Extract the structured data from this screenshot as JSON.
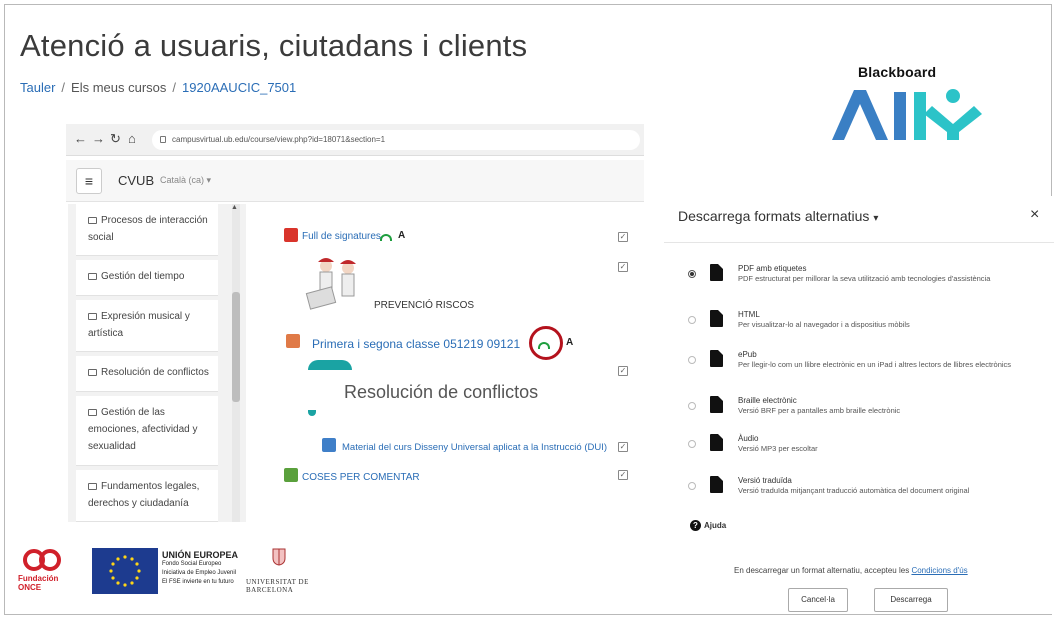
{
  "header": {
    "title": "Atenció a usuaris, ciutadans i clients",
    "breadcrumb": [
      "Tauler",
      "Els meus cursos",
      "1920AAUCIC_7501"
    ]
  },
  "logos": {
    "blackboard": "Blackboard",
    "ally": "ALLY"
  },
  "browser": {
    "url": "campusvirtual.ub.edu/course/view.php?id=18071&section=1",
    "site_name": "CVUB",
    "lang": "Català (ca) ▾"
  },
  "sidebar": {
    "items": [
      {
        "label": "Procesos de interacción social"
      },
      {
        "label": "Gestión del tiempo"
      },
      {
        "label": "Expresión musical y artística"
      },
      {
        "label": "Resolución de conflictos"
      },
      {
        "label": "Gestión de las emociones, afectividad y sexualidad"
      },
      {
        "label": "Fundamentos legales, derechos y ciudadanía"
      }
    ]
  },
  "content": {
    "activity1": "Full de signatures",
    "label1": "PREVENCIÓ RISCOS",
    "activity2": "Primera i segona classe 051219 09121",
    "big_label": "Resolución de conflictos",
    "activity3": "Material del curs Disseny Universal aplicat a la Instrucció (DUI)",
    "activity4": "COSES PER COMENTAR",
    "a_icon": "A"
  },
  "panel": {
    "title": "Descarrega formats alternatius",
    "close": "×",
    "formats": [
      {
        "name": "PDF amb etiquetes",
        "desc": "PDF estructurat per millorar la seva utilització amb tecnologies d'assistència",
        "selected": true
      },
      {
        "name": "HTML",
        "desc": "Per visualitzar-lo al navegador i a dispositius mòbils",
        "selected": false
      },
      {
        "name": "ePub",
        "desc": "Per llegir-lo com un llibre electrònic en un iPad i altres lectors de llibres electrònics",
        "selected": false
      },
      {
        "name": "Braille electrònic",
        "desc": "Versió BRF per a pantalles amb braille electrònic",
        "selected": false
      },
      {
        "name": "Àudio",
        "desc": "Versió MP3 per escoltar",
        "selected": false
      },
      {
        "name": "Versió traduïda",
        "desc": "Versió traduïda mitjançant traducció automàtica del document original",
        "selected": false
      }
    ],
    "help": "Ajuda",
    "terms_prefix": "En descarregar un format alternatiu, accepteu les ",
    "terms_link": "Condicions d'ús",
    "cancel": "Cancel·la",
    "download": "Descarrega"
  },
  "footer": {
    "once": "Fundación ONCE",
    "eu_title": "UNIÓN EUROPEA",
    "eu_fund": "Fondo Social Europeo",
    "eu_line1": "Iniciativa de Empleo Juvenil",
    "eu_line2": "El FSE invierte en tu futuro",
    "ub_line1": "UNIVERSITAT DE",
    "ub_line2": "BARCELONA"
  },
  "colors": {
    "link": "#2a6db6",
    "ally_blue": "#3a7fc4",
    "ally_teal": "#2cc3c8",
    "highlight_red": "#b4121d",
    "gauge_green": "#1e9e3e"
  }
}
